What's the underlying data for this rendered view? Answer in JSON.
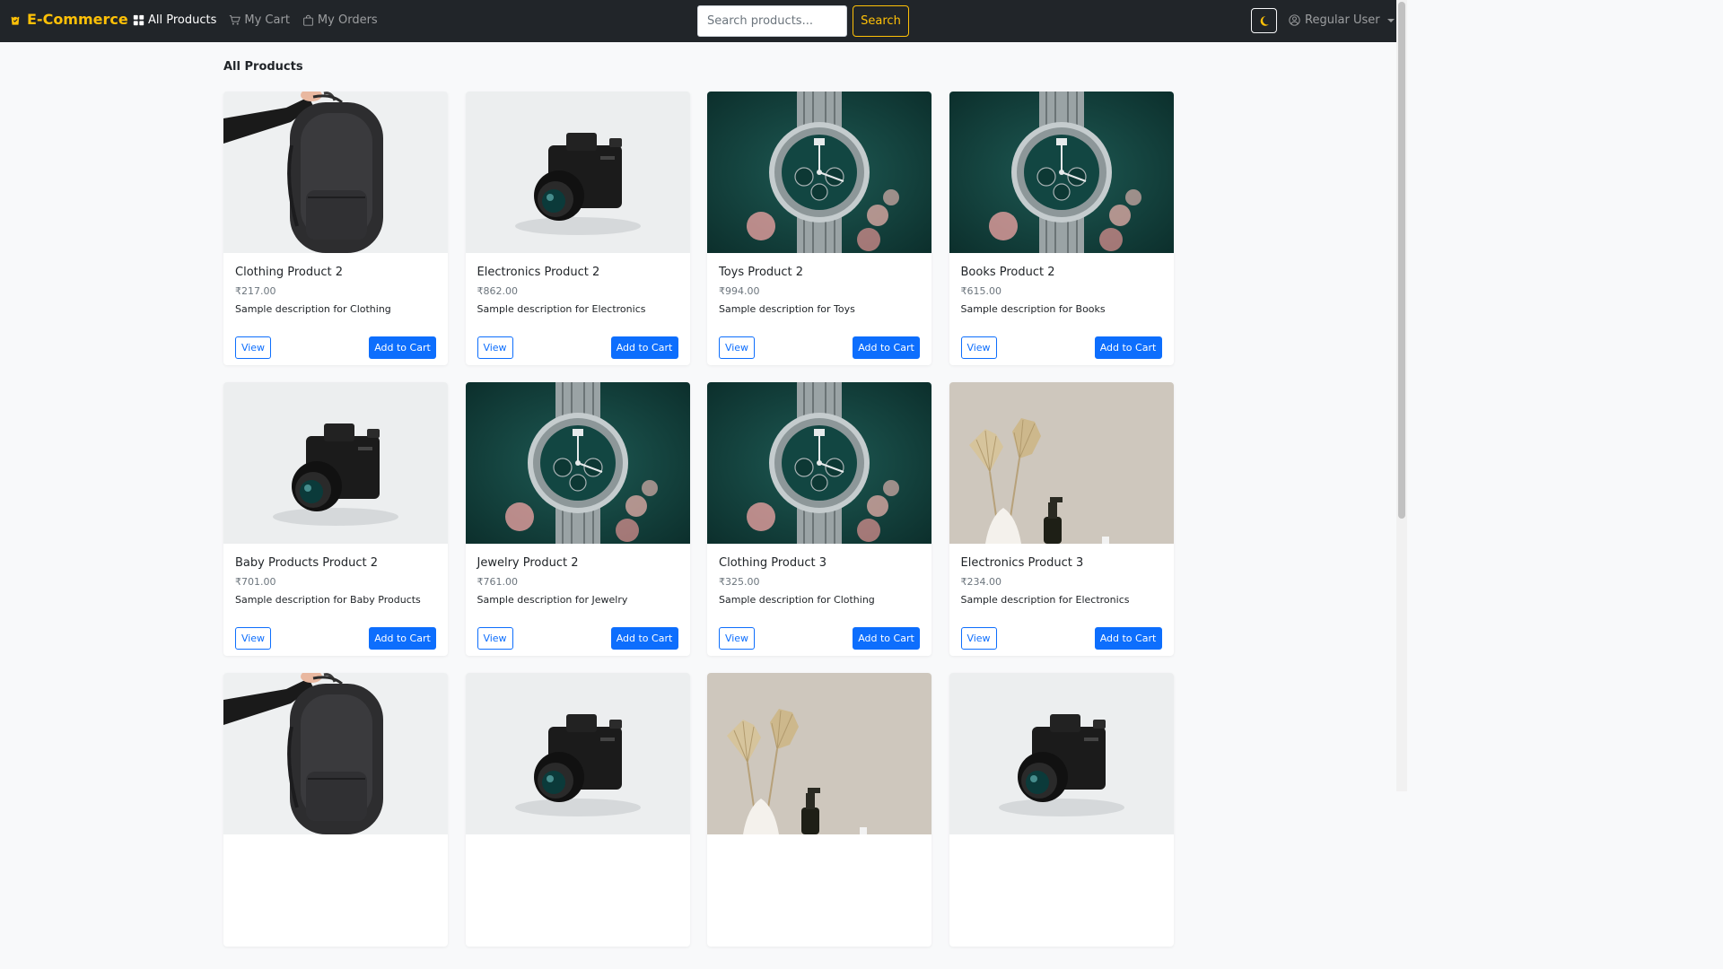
{
  "navbar": {
    "brand": "E-Commerce",
    "links": [
      {
        "label": "All Products",
        "icon": "grid-icon",
        "active": true
      },
      {
        "label": "My Cart",
        "icon": "cart-icon",
        "active": false
      },
      {
        "label": "My Orders",
        "icon": "bag-icon",
        "active": false
      }
    ],
    "search_placeholder": "Search products...",
    "search_label": "Search",
    "theme_icon": "moon-icon",
    "user_label": "Regular User",
    "user_icon": "person-circle-icon"
  },
  "main": {
    "title": "All Products",
    "view_label": "View",
    "add_label": "Add to Cart"
  },
  "products": [
    {
      "name": "Clothing Product 2",
      "price": "₹217.00",
      "description": "Sample description for Clothing",
      "image": "backpack"
    },
    {
      "name": "Electronics Product 2",
      "price": "₹862.00",
      "description": "Sample description for Electronics",
      "image": "camera"
    },
    {
      "name": "Toys Product 2",
      "price": "₹994.00",
      "description": "Sample description for Toys",
      "image": "watch"
    },
    {
      "name": "Books Product 2",
      "price": "₹615.00",
      "description": "Sample description for Books",
      "image": "watch"
    },
    {
      "name": "Baby Products Product 2",
      "price": "₹701.00",
      "description": "Sample description for Baby Products",
      "image": "camera"
    },
    {
      "name": "Jewelry Product 2",
      "price": "₹761.00",
      "description": "Sample description for Jewelry",
      "image": "watch"
    },
    {
      "name": "Clothing Product 3",
      "price": "₹325.00",
      "description": "Sample description for Clothing",
      "image": "watch"
    },
    {
      "name": "Electronics Product 3",
      "price": "₹234.00",
      "description": "Sample description for Electronics",
      "image": "plants"
    },
    {
      "name": "",
      "price": "",
      "description": "",
      "image": "backpack"
    },
    {
      "name": "",
      "price": "",
      "description": "",
      "image": "camera"
    },
    {
      "name": "",
      "price": "",
      "description": "",
      "image": "plants"
    },
    {
      "name": "",
      "price": "",
      "description": "",
      "image": "camera"
    }
  ],
  "colors": {
    "navbar_bg": "#212529",
    "brand": "#ffc107",
    "primary": "#0d6efd",
    "page_bg": "#f8f9fa"
  }
}
